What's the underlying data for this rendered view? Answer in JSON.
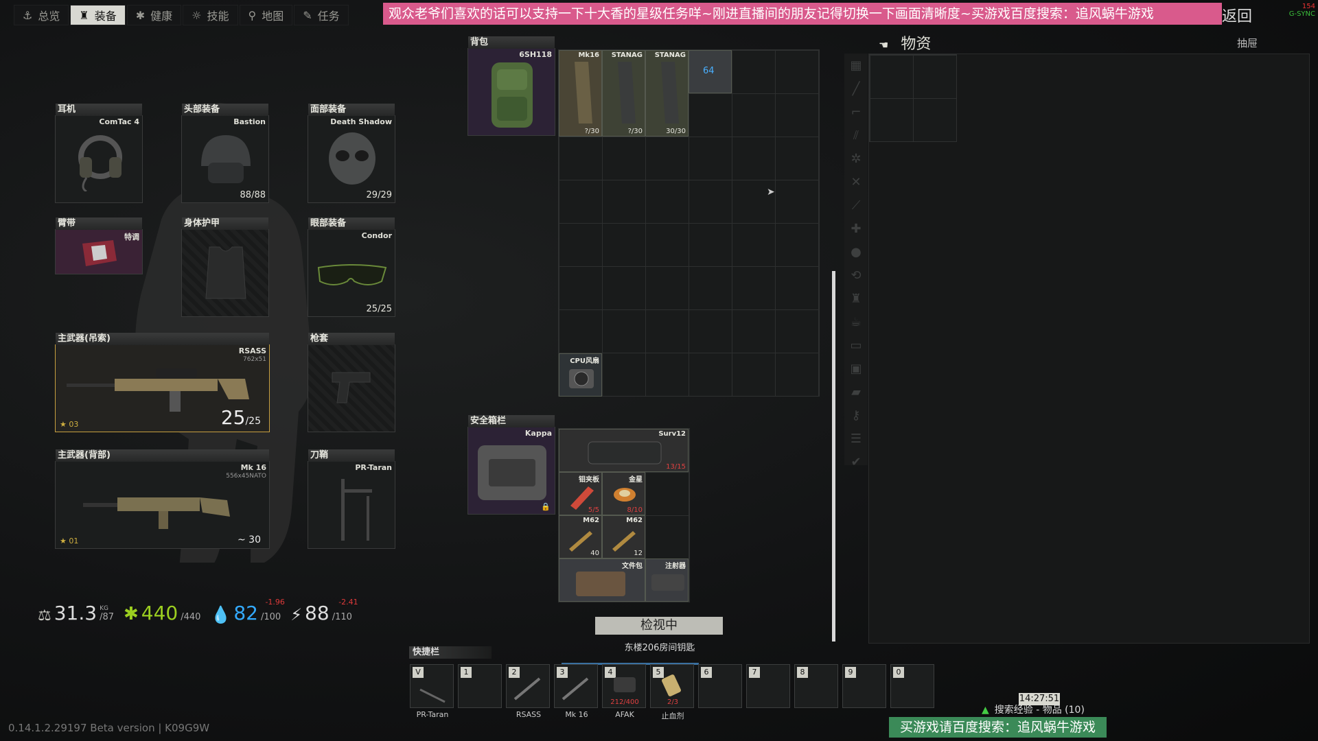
{
  "nav": {
    "tabs": [
      {
        "label": "总览",
        "icon": "anchor-icon"
      },
      {
        "label": "装备",
        "icon": "gear-body-icon"
      },
      {
        "label": "健康",
        "icon": "health-icon"
      },
      {
        "label": "技能",
        "icon": "skills-icon"
      },
      {
        "label": "地图",
        "icon": "map-pin-icon"
      },
      {
        "label": "任务",
        "icon": "quest-icon"
      }
    ],
    "active_tab": "装备",
    "back_label": "返回"
  },
  "banner": "观众老爷们喜欢的话可以支持一下十大香的星级任务咩~刚进直播间的朋友记得切换一下画面清晰度~买游戏百度搜索：追风蜗牛游戏",
  "fps": {
    "value": "154",
    "sync": "G-SYNC"
  },
  "equipment": {
    "earpiece": {
      "header": "耳机",
      "name": "ComTac 4"
    },
    "headwear": {
      "header": "头部装备",
      "name": "Bastion",
      "count": "88/88"
    },
    "facecover": {
      "header": "面部装备",
      "name": "Death Shadow",
      "count": "29/29"
    },
    "armband": {
      "header": "臂带",
      "name": "特调"
    },
    "body_armor": {
      "header": "身体护甲"
    },
    "eyewear": {
      "header": "眼部装备",
      "name": "Condor",
      "count": "25/25"
    },
    "primary_sling": {
      "header": "主武器(吊索)",
      "name": "RSASS",
      "caliber": "762x51",
      "ammo": "25",
      "ammo_max": "/25",
      "rank": "03"
    },
    "holster": {
      "header": "枪套"
    },
    "primary_back": {
      "header": "主武器(背部)",
      "name": "Mk 16",
      "caliber": "556x45NATO",
      "ammo": "~ 30",
      "rank": "01"
    },
    "scabbard": {
      "header": "刀鞘",
      "name": "PR-Taran"
    }
  },
  "stats": {
    "weight": "31.3",
    "weight_unit": "KG",
    "weight_max": "/87",
    "health": "440",
    "health_max": "/440",
    "hydration": "82",
    "hydration_max": "/100",
    "hydration_delta": "-1.96",
    "energy": "88",
    "energy_max": "/110",
    "energy_delta": "-2.41"
  },
  "backpack": {
    "header": "背包",
    "name": "6SH118",
    "items": [
      {
        "name": "Mk16",
        "count": "?/30"
      },
      {
        "name": "STANAG",
        "count": "?/30"
      },
      {
        "name": "STANAG",
        "count": "30/30"
      },
      {
        "name": "",
        "count": "64"
      },
      {
        "name": "CPU风扇",
        "count": ""
      }
    ]
  },
  "secure": {
    "header": "安全箱栏",
    "name": "Kappa",
    "items": [
      {
        "name": "Surv12",
        "count": "13/15"
      },
      {
        "name": "钼夹板",
        "count": "5/5"
      },
      {
        "name": "金星",
        "count": "8/10"
      },
      {
        "name": "M62",
        "count": "40"
      },
      {
        "name": "M62",
        "count": "12"
      },
      {
        "name": "文件包",
        "count": ""
      },
      {
        "name": "注射器",
        "count": ""
      }
    ]
  },
  "status": {
    "examining": "检视中",
    "examining_item": "东楼206房间钥匙"
  },
  "stash": {
    "title": "物资",
    "drawer": "抽屉"
  },
  "hotbar": {
    "title": "快捷栏",
    "slots": [
      {
        "key": "V",
        "label": "PR-Taran",
        "count": ""
      },
      {
        "key": "1",
        "label": "",
        "count": ""
      },
      {
        "key": "2",
        "label": "RSASS",
        "count": ""
      },
      {
        "key": "3",
        "label": "Mk 16",
        "count": ""
      },
      {
        "key": "4",
        "label": "AFAK",
        "count": "212/400"
      },
      {
        "key": "5",
        "label": "止血剂",
        "count": "2/3"
      },
      {
        "key": "6",
        "label": "",
        "count": ""
      },
      {
        "key": "7",
        "label": "",
        "count": ""
      },
      {
        "key": "8",
        "label": "",
        "count": ""
      },
      {
        "key": "9",
        "label": "",
        "count": ""
      },
      {
        "key": "0",
        "label": "",
        "count": ""
      }
    ]
  },
  "footer": {
    "version": "0.14.1.2.29197 Beta version | K09G9W",
    "time": "14:27:51",
    "search_exp": "搜索经验 - 物品 (10)",
    "promo": "买游戏请百度搜索：追风蜗牛游戏"
  }
}
